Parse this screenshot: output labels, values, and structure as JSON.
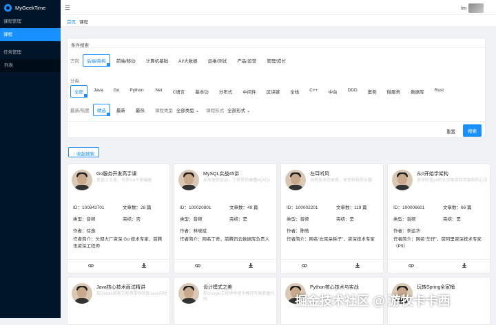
{
  "app": {
    "title": "MyGeekTime"
  },
  "sidebar": {
    "items": [
      {
        "label": "课程管理",
        "kind": "group"
      },
      {
        "label": "课程",
        "kind": "active"
      },
      {
        "label": "任务管理",
        "kind": "group"
      },
      {
        "label": "列表",
        "kind": "sub"
      }
    ]
  },
  "topbar": {
    "menu_icon": "menu-fold-icon",
    "user": "lm"
  },
  "breadcrumb": {
    "home": "首页",
    "current": "课程"
  },
  "filter": {
    "title": "条件搜索",
    "direction": {
      "label": "方向",
      "options": [
        "后端/架构",
        "前端/移动",
        "计算机基础",
        "AI/大数据",
        "运维/测试",
        "产品/运营",
        "管理/成长"
      ],
      "selected": 0
    },
    "category": {
      "label": "分类",
      "options": [
        "全部",
        "Java",
        "Go",
        "Python",
        ".Net",
        "C语言",
        "基本功",
        "分布式",
        "中间件",
        "区块链",
        "全栈",
        "C++",
        "中台",
        "DDD",
        "案例",
        "微服务",
        "数据库",
        "Rust"
      ],
      "selected": 0
    },
    "sort": {
      "label": "最新/热度",
      "options": [
        "精选",
        "最新",
        "最热"
      ],
      "selected": 0
    },
    "type_label": "课程类型",
    "type_value": "全部类型",
    "form_label": "课程形式",
    "form_value": "全部形式",
    "reset": "重置",
    "search": "搜索"
  },
  "collapse": "收起搜索",
  "labels": {
    "id": "ID：",
    "articles": "文章数：",
    "type": "类型：",
    "done": "完结：",
    "author": "作者：",
    "intro": "作者简介："
  },
  "cards": [
    {
      "title": "Go服务开发高手课",
      "desc": "复现上王者，写资Go开发编器",
      "id": "100843701",
      "articles": "28 篇",
      "type": "音频",
      "done": "否",
      "author": "徐逸",
      "intro": "头部大厂资深 Go 技术专家、前腾讯资深工程师"
    },
    {
      "title": "MySQL实战45讲",
      "desc": "从原理到实战，丁奇带你搞懂MySQL",
      "id": "100020801",
      "articles": "49 篇",
      "type": "音频",
      "done": "是",
      "author": "林晓斌",
      "intro": "网名丁奇，前腾讯云数据库负责人"
    },
    {
      "title": "左耳听风",
      "desc": "洞悉技术的本质，享受科技的乐趣",
      "id": "100002201",
      "articles": "119 篇",
      "type": "音频",
      "done": "是",
      "author": "陈皓",
      "intro": "网名“左耳朵耗子”，资深技术专家"
    },
    {
      "title": "从0开始学架构",
      "desc": "资深阿里p9的大手笔带你学架构的心法",
      "id": "100006601",
      "articles": "66 篇",
      "type": "音频",
      "done": "是",
      "author": "李运华",
      "intro": "网名“华仔”，前阿里资深技术专家（P9）"
    },
    {
      "title": "Java核心技术面试精讲",
      "desc": "前Oracle首席工程师带你修炼Java内功",
      "id": "",
      "articles": "",
      "type": "",
      "done": "",
      "author": "",
      "intro": ""
    },
    {
      "title": "设计模式之美",
      "desc": "前Google工程师手把手教你写高质量代码",
      "id": "",
      "articles": "",
      "type": "",
      "done": "",
      "author": "",
      "intro": ""
    },
    {
      "title": "Python核心技术与实战",
      "desc": "",
      "id": "",
      "articles": "",
      "type": "",
      "done": "",
      "author": "",
      "intro": ""
    },
    {
      "title": "玩转Spring全家桶",
      "desc": "",
      "id": "",
      "articles": "",
      "type": "",
      "done": "",
      "author": "",
      "intro": ""
    }
  ],
  "watermark": "掘金技术社区 @ 游牧卡卡西"
}
